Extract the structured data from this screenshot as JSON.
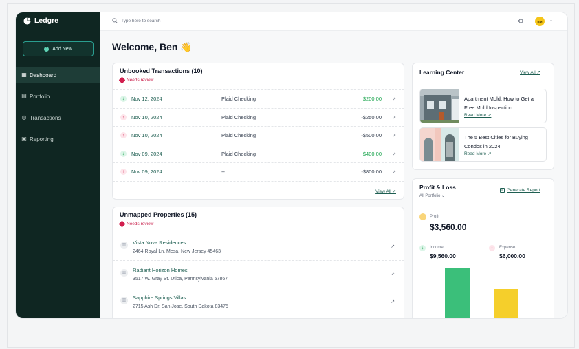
{
  "app": {
    "brand": "Ledgre"
  },
  "sidebar": {
    "add_new": "Add New",
    "items": [
      {
        "label": "Dashboard",
        "icon": "grid-icon",
        "active": true
      },
      {
        "label": "Portfolio",
        "icon": "building-icon",
        "active": false
      },
      {
        "label": "Transactions",
        "icon": "clock-icon",
        "active": false
      },
      {
        "label": "Reporting",
        "icon": "document-icon",
        "active": false
      }
    ]
  },
  "topbar": {
    "search_placeholder": "Type here to search",
    "avatar_initials": "BM"
  },
  "welcome": {
    "text": "Welcome, Ben 👋"
  },
  "unbooked": {
    "title": "Unbooked Transactions (10)",
    "status": "Needs review",
    "view_all": "View All ↗",
    "rows": [
      {
        "direction": "in",
        "date": "Nov 12, 2024",
        "account": "Plaid Checking",
        "amount": "$200.00"
      },
      {
        "direction": "out",
        "date": "Nov 10, 2024",
        "account": "Plaid Checking",
        "amount": "-$250.00"
      },
      {
        "direction": "out",
        "date": "Nov 10, 2024",
        "account": "Plaid Checking",
        "amount": "-$500.00"
      },
      {
        "direction": "in",
        "date": "Nov 09, 2024",
        "account": "Plaid Checking",
        "amount": "$400.00"
      },
      {
        "direction": "out",
        "date": "Nov 09, 2024",
        "account": "--",
        "amount": "-$800.00"
      }
    ]
  },
  "unmapped": {
    "title": "Unmapped Properties (15)",
    "status": "Needs review",
    "rows": [
      {
        "name": "Vista Nova Residences",
        "address": "2464 Royal Ln. Mesa, New Jersey 45463"
      },
      {
        "name": "Radiant Horizon Homes",
        "address": "3517 W. Gray St. Utica, Pennsylvania 57867"
      },
      {
        "name": "Sapphire Springs Villas",
        "address": "2715 Ash Dr. San Jose, South Dakota 83475"
      }
    ]
  },
  "learning": {
    "title": "Learning Center",
    "view_all": "View All ↗",
    "items": [
      {
        "title": "Apartment Mold: How to Get a Free Mold Inspection",
        "read": "Read More ↗"
      },
      {
        "title": "The 5 Best Cities for Buying Condos in 2024",
        "read": "Read More ↗"
      }
    ]
  },
  "pnl": {
    "title": "Profit & Loss",
    "filter": "All Portfolio ⌄",
    "generate": "Generate Report",
    "profit_label": "Profit",
    "profit_value": "$3,560.00",
    "income_label": "Income",
    "income_value": "$9,560.00",
    "expense_label": "Expense",
    "expense_value": "$6,000.00",
    "colors": {
      "income": "#3bbf7a",
      "expense": "#f5cf2b",
      "profit": "#f9d57a"
    }
  }
}
